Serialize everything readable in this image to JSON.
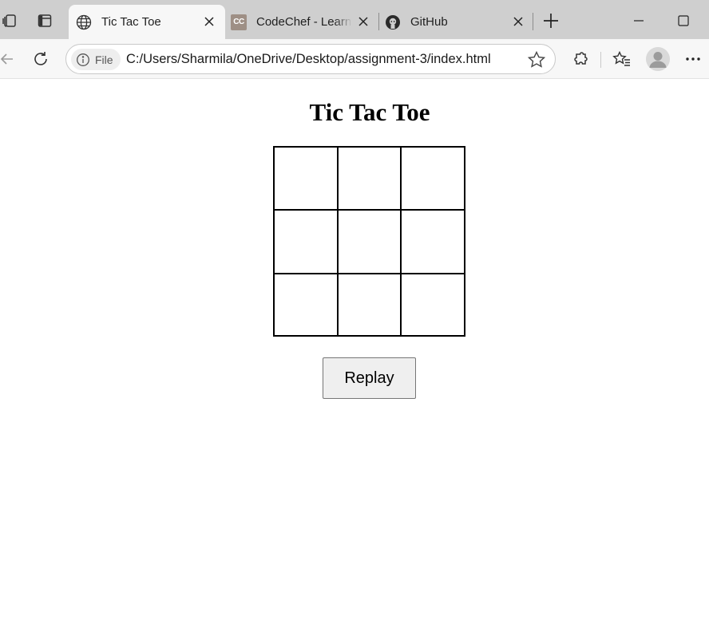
{
  "browser": {
    "tabs": [
      {
        "title": "Tic Tac Toe",
        "icon": "globe-icon",
        "active": true
      },
      {
        "title": "CodeChef - Learn",
        "icon": "codechef-icon",
        "favicon_text": "CC",
        "active": false
      },
      {
        "title": "GitHub",
        "icon": "github-icon",
        "active": false
      }
    ],
    "address_bar": {
      "site_info_label": "File",
      "url": "C:/Users/Sharmila/OneDrive/Desktop/assignment-3/index.html"
    }
  },
  "page": {
    "title": "Tic Tac Toe",
    "board": [
      "",
      "",
      "",
      "",
      "",
      "",
      "",
      "",
      ""
    ],
    "replay_label": "Replay"
  },
  "colors": {
    "tab_strip": "#cfcfcf",
    "toolbar": "#f7f7f7",
    "grid_line": "#000000",
    "button_bg": "#efefef"
  }
}
